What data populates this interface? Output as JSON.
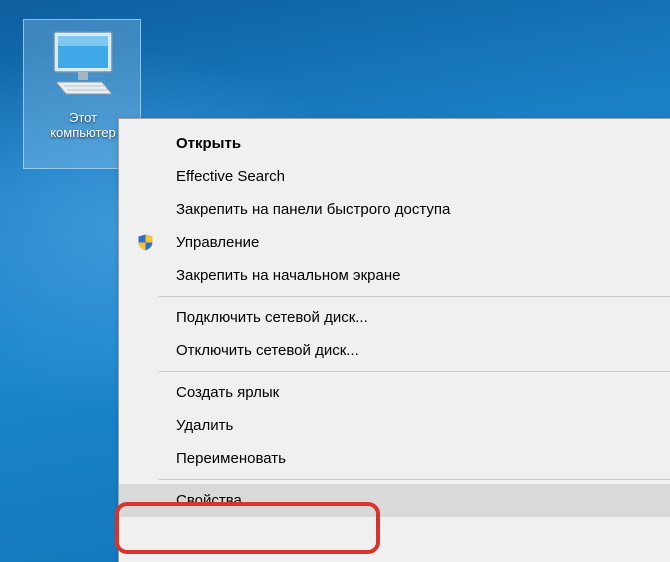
{
  "desktop": {
    "icon": {
      "name": "computer-icon",
      "label_line1": "Этот",
      "label_line2": "компьютер"
    }
  },
  "context_menu": {
    "groups": [
      [
        {
          "label": "Открыть",
          "bold": true
        },
        {
          "label": "Effective Search"
        },
        {
          "label": "Закрепить на панели быстрого доступа"
        },
        {
          "label": "Управление",
          "icon": "shield-icon"
        },
        {
          "label": "Закрепить на начальном экране"
        }
      ],
      [
        {
          "label": "Подключить сетевой диск..."
        },
        {
          "label": "Отключить сетевой диск..."
        }
      ],
      [
        {
          "label": "Создать ярлык"
        },
        {
          "label": "Удалить"
        },
        {
          "label": "Переименовать"
        }
      ],
      [
        {
          "label": "Свойства",
          "highlighted": true
        }
      ]
    ]
  },
  "colors": {
    "highlight_ring": "#d9342c",
    "menu_background": "#f0f0f0",
    "hover_background": "#d9d9d9"
  }
}
